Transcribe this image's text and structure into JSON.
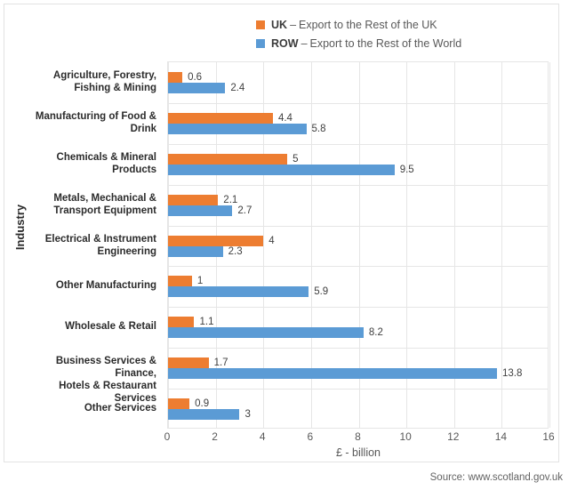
{
  "legend": {
    "items": [
      {
        "key": "UK",
        "dash": "–",
        "description": "Export to the Rest of the UK",
        "color": "#ED7D31"
      },
      {
        "key": "ROW",
        "dash": "–",
        "description": "Export to the Rest of the World",
        "color": "#5B9BD5"
      }
    ]
  },
  "source": "Source: www.scotland.gov.uk",
  "chart_data": {
    "type": "bar",
    "orientation": "horizontal",
    "title": "",
    "xlabel": "£ - billion",
    "ylabel": "Industry",
    "xlim": [
      0,
      16
    ],
    "xticks": [
      "0",
      "2",
      "4",
      "6",
      "8",
      "10",
      "12",
      "14",
      "16"
    ],
    "grid": true,
    "legend_position": "top-right",
    "categories": [
      "Agriculture, Forestry, Fishing & Mining",
      "Manufacturing of Food & Drink",
      "Chemicals & Mineral Products",
      "Metals, Mechanical & Transport Equipment",
      "Electrical & Instrument Engineering",
      "Other Manufacturing",
      "Wholesale & Retail",
      "Business Services & Finance, Hotels & Restaurant Services",
      "Other Services"
    ],
    "category_lines": [
      [
        "Agriculture, Forestry,",
        "Fishing & Mining"
      ],
      [
        "Manufacturing of Food &",
        "Drink"
      ],
      [
        "Chemicals & Mineral",
        "Products"
      ],
      [
        "Metals, Mechanical &",
        "Transport Equipment"
      ],
      [
        "Electrical & Instrument",
        "Engineering"
      ],
      [
        "Other Manufacturing"
      ],
      [
        "Wholesale & Retail"
      ],
      [
        "Business Services & Finance,",
        "Hotels & Restaurant Services"
      ],
      [
        "Other Services"
      ]
    ],
    "series": [
      {
        "name": "UK",
        "color": "#ED7D31",
        "values": [
          0.6,
          4.4,
          5,
          2.1,
          4,
          1,
          1.1,
          1.7,
          0.9
        ],
        "labels": [
          "0.6",
          "4.4",
          "5",
          "2.1",
          "4",
          "1",
          "1.1",
          "1.7",
          "0.9"
        ]
      },
      {
        "name": "ROW",
        "color": "#5B9BD5",
        "values": [
          2.4,
          5.8,
          9.5,
          2.7,
          2.3,
          5.9,
          8.2,
          13.8,
          3
        ],
        "labels": [
          "2.4",
          "5.8",
          "9.5",
          "2.7",
          "2.3",
          "5.9",
          "8.2",
          "13.8",
          "3"
        ]
      }
    ]
  }
}
